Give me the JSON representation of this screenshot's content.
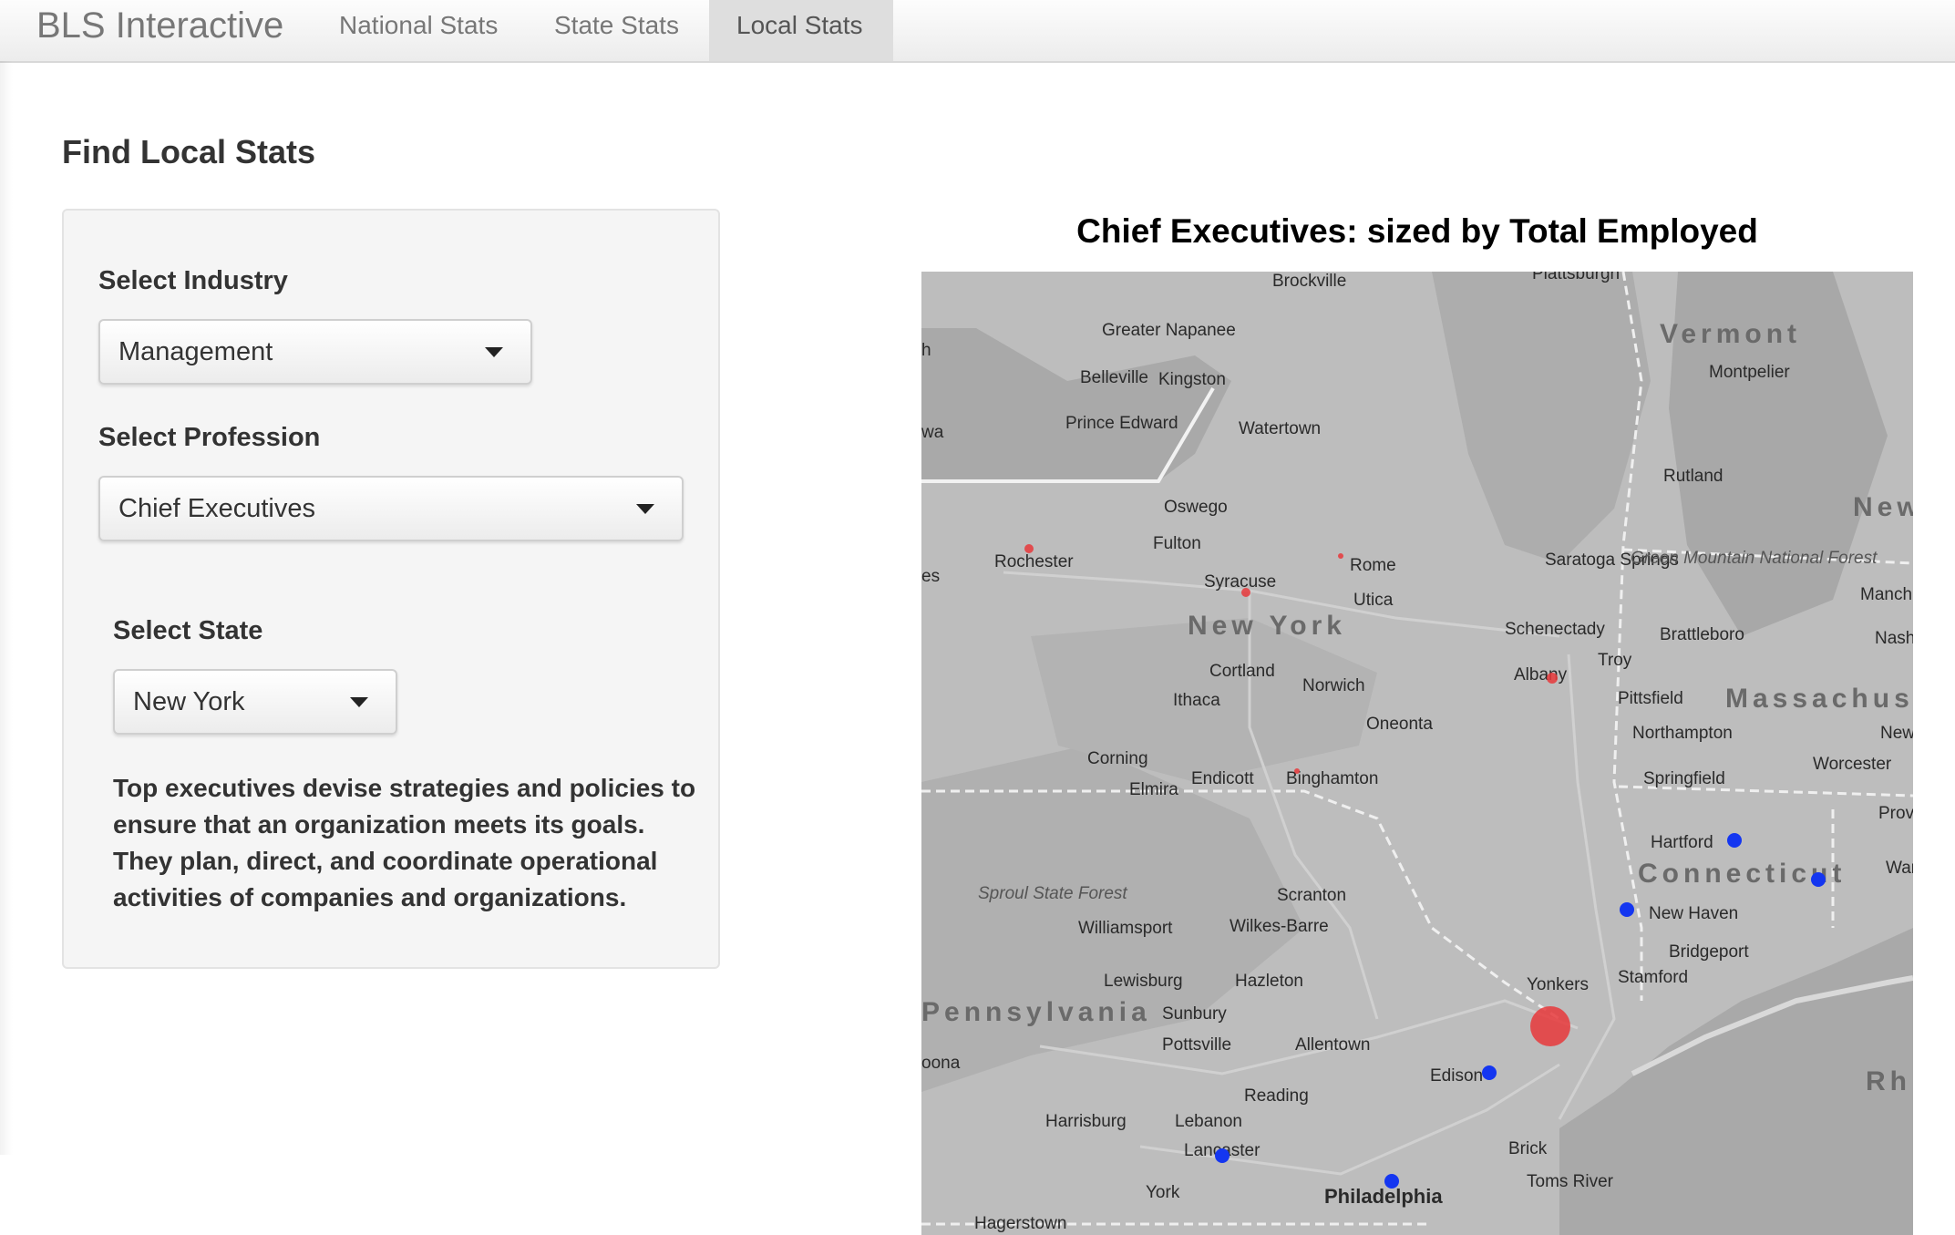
{
  "navbar": {
    "brand": "BLS Interactive",
    "tabs": [
      {
        "label": "National Stats",
        "active": false
      },
      {
        "label": "State Stats",
        "active": false
      },
      {
        "label": "Local Stats",
        "active": true
      }
    ]
  },
  "page": {
    "title": "Find Local Stats"
  },
  "form": {
    "industry": {
      "label": "Select Industry",
      "value": "Management"
    },
    "profession": {
      "label": "Select Profession",
      "value": "Chief Executives"
    },
    "state": {
      "label": "Select State",
      "value": "New York"
    },
    "description": "Top executives devise strategies and policies to ensure that an organization meets its goals. They plan, direct, and coordinate operational activities of companies and organizations."
  },
  "map": {
    "title": "Chief Executives: sized by Total Employed",
    "regions": [
      "Vermont",
      "New Hamps",
      "Massachus",
      "Connecticut",
      "New York",
      "Pennsylvania",
      "Rh"
    ],
    "cities": [
      "Plattsburgh",
      "Brockville",
      "Greater Napanee",
      "Belleville",
      "Kingston",
      "Prince Edward",
      "Watertown",
      "Oswego",
      "Fulton",
      "Rochester",
      "Syracuse",
      "Rome",
      "Utica",
      "Saratoga Springs",
      "Schenectady",
      "Troy",
      "Albany",
      "Montpelier",
      "Rutland",
      "Green Mountain National Forest",
      "Brattleboro",
      "Manch",
      "Nash",
      "Cortland",
      "Norwich",
      "Ithaca",
      "Oneonta",
      "Pittsfield",
      "Northampton",
      "Springfield",
      "Worcester",
      "Newt",
      "Provi",
      "War",
      "Corning",
      "Elmira",
      "Endicott",
      "Binghamton",
      "Hartford",
      "New Haven",
      "Bridgeport",
      "Stamford",
      "Yonkers",
      "Sproul State Forest",
      "Williamsport",
      "Scranton",
      "Wilkes-Barre",
      "Lewisburg",
      "Hazleton",
      "Sunbury",
      "Pottsville",
      "Allentown",
      "Edison",
      "Reading",
      "Harrisburg",
      "Lebanon",
      "Lancaster",
      "York",
      "Philadelphia",
      "Brick",
      "Toms River",
      "Hagerstown",
      "oona",
      "wa",
      "es",
      "h"
    ],
    "colors": {
      "red_marker": "#e8383b",
      "blue_marker": "#1436f0",
      "land": "#bdbdbd",
      "water": "#a9a9a9"
    },
    "markers": [
      {
        "name": "Rochester",
        "color": "red",
        "size": "small"
      },
      {
        "name": "Syracuse",
        "color": "red",
        "size": "small"
      },
      {
        "name": "Rome",
        "color": "red",
        "size": "small"
      },
      {
        "name": "Albany",
        "color": "red",
        "size": "small"
      },
      {
        "name": "Binghamton",
        "color": "red",
        "size": "small"
      },
      {
        "name": "New York",
        "color": "red",
        "size": "large"
      },
      {
        "name": "Hartford",
        "color": "blue",
        "size": "small"
      },
      {
        "name": "New Haven",
        "color": "blue",
        "size": "small"
      },
      {
        "name": "Norwich CT",
        "color": "blue",
        "size": "small"
      },
      {
        "name": "Edison",
        "color": "blue",
        "size": "small"
      },
      {
        "name": "Lancaster",
        "color": "blue",
        "size": "small"
      },
      {
        "name": "Philadelphia",
        "color": "blue",
        "size": "small"
      }
    ]
  }
}
